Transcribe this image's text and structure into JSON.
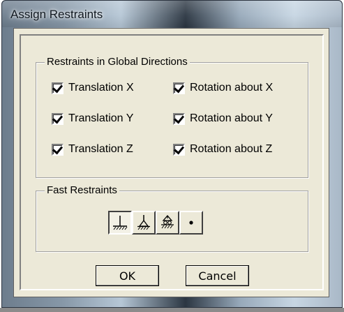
{
  "window": {
    "title": "Assign Restraints"
  },
  "global_group": {
    "legend": "Restraints in Global Directions",
    "translations": [
      {
        "label": "Translation X",
        "checked": true
      },
      {
        "label": "Translation Y",
        "checked": true
      },
      {
        "label": "Translation Z",
        "checked": true
      }
    ],
    "rotations": [
      {
        "label": "Rotation about X",
        "checked": true
      },
      {
        "label": "Rotation about Y",
        "checked": true
      },
      {
        "label": "Rotation about Z",
        "checked": true
      }
    ]
  },
  "fast_group": {
    "legend": "Fast Restraints",
    "buttons": [
      {
        "icon": "fixed-support-icon",
        "pressed": true
      },
      {
        "icon": "pinned-support-icon",
        "pressed": false
      },
      {
        "icon": "roller-support-icon",
        "pressed": false
      },
      {
        "icon": "free-node-icon",
        "pressed": false
      }
    ]
  },
  "actions": {
    "ok": "OK",
    "cancel": "Cancel"
  }
}
